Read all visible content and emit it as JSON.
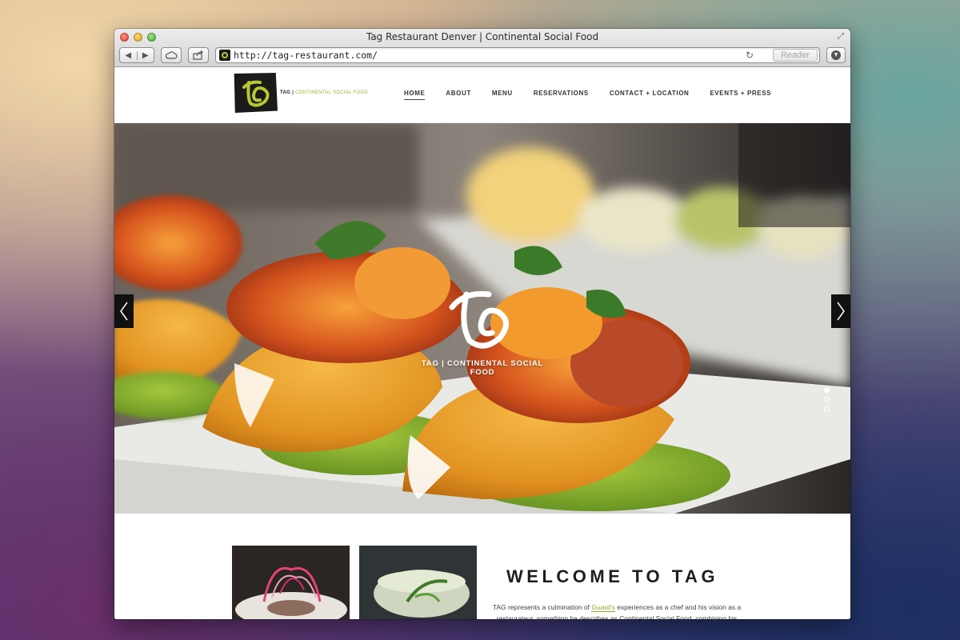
{
  "browser": {
    "window_title": "Tag Restaurant Denver | Continental Social Food",
    "url": "http://tag-restaurant.com/",
    "reader_label": "Reader"
  },
  "site": {
    "logo": {
      "name": "TAG",
      "tagline": "CONTINENTAL SOCIAL FOOD"
    },
    "nav": [
      {
        "label": "HOME",
        "active": true
      },
      {
        "label": "ABOUT"
      },
      {
        "label": "MENU"
      },
      {
        "label": "RESERVATIONS"
      },
      {
        "label": "CONTACT + LOCATION"
      },
      {
        "label": "EVENTS + PRESS"
      }
    ],
    "hero": {
      "tagline": "TAG | CONTINENTAL SOCIAL FOOD",
      "slide_count": 3,
      "active_slide": 1
    },
    "welcome": {
      "title": "WELCOME TO TAG",
      "body_before": "TAG represents a culmination of ",
      "body_link": "Guard's",
      "body_after": " experiences as a chef and his vision as a restaurateur, something he describes as Continental Social Food, combining his Hawaiian"
    }
  },
  "colors": {
    "accent": "#a5b52b",
    "nav_text": "#333333",
    "title_text": "#1f1f1f"
  }
}
